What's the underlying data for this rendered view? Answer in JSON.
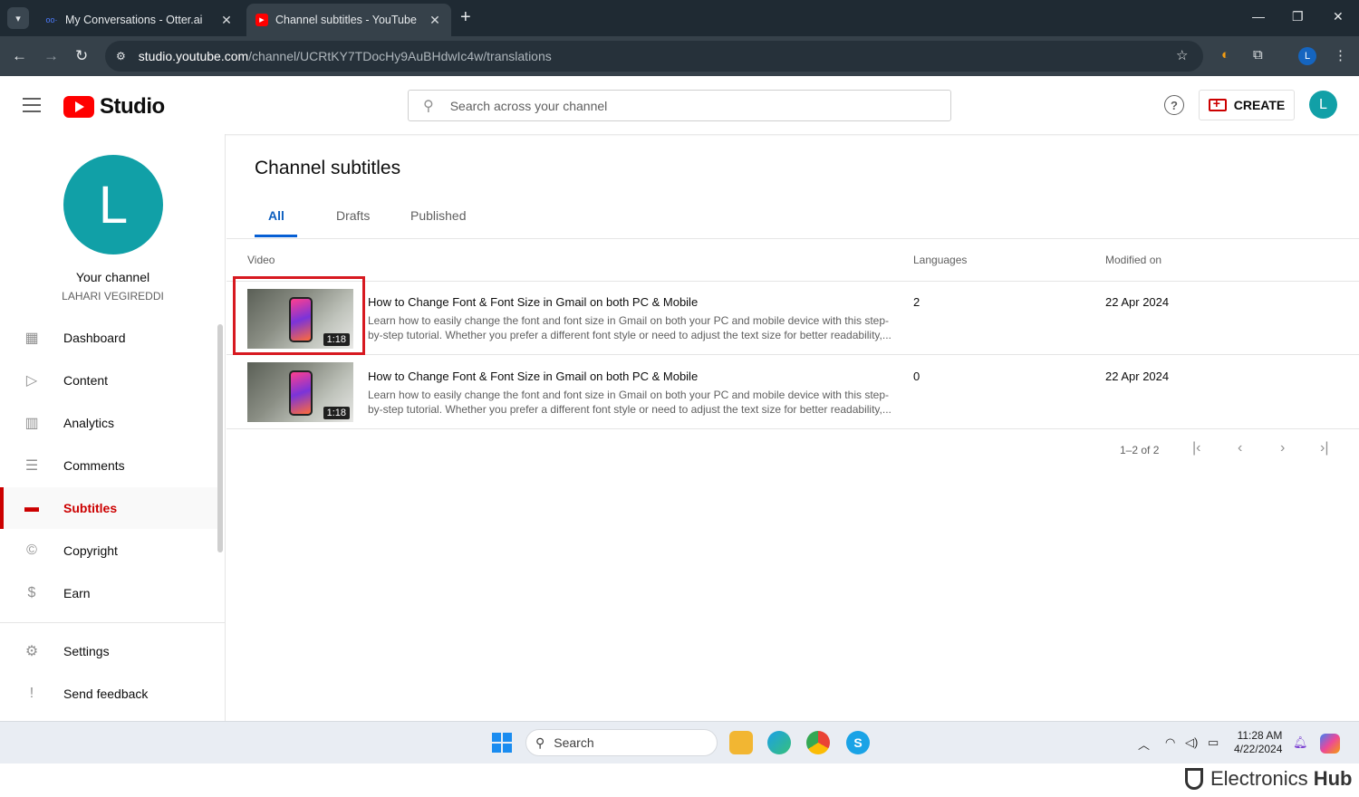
{
  "browser": {
    "tabs": [
      {
        "title": "My Conversations - Otter.ai",
        "active": false
      },
      {
        "title": "Channel subtitles - YouTube Stu",
        "active": true
      }
    ],
    "url_host": "studio.youtube.com",
    "url_path": "/channel/UCRtKY7TDocHy9AuBHdwIc4w/translations",
    "profile_initial": "L"
  },
  "header": {
    "logo_text": "Studio",
    "search_placeholder": "Search across your channel",
    "create_label": "CREATE",
    "avatar_initial": "L"
  },
  "sidebar": {
    "avatar_initial": "L",
    "your_channel": "Your channel",
    "channel_name": "LAHARI VEGIREDDI",
    "items": [
      {
        "label": "Dashboard",
        "icon": "dashboard-icon"
      },
      {
        "label": "Content",
        "icon": "content-icon"
      },
      {
        "label": "Analytics",
        "icon": "analytics-icon"
      },
      {
        "label": "Comments",
        "icon": "comments-icon"
      },
      {
        "label": "Subtitles",
        "icon": "subtitles-icon",
        "active": true
      },
      {
        "label": "Copyright",
        "icon": "copyright-icon"
      },
      {
        "label": "Earn",
        "icon": "earn-icon"
      }
    ],
    "settings": "Settings",
    "feedback": "Send feedback"
  },
  "main": {
    "title": "Channel subtitles",
    "tabs": [
      "All",
      "Drafts",
      "Published"
    ],
    "columns": {
      "video": "Video",
      "languages": "Languages",
      "modified": "Modified on"
    },
    "rows": [
      {
        "title": "How to Change Font & Font Size in Gmail on both PC & Mobile",
        "desc": "Learn how to easily change the font and font size in Gmail on both your PC and mobile device with this step-by-step tutorial. Whether you prefer a different font style or need to adjust the text size for better readability,...",
        "duration": "1:18",
        "languages": "2",
        "modified": "22 Apr 2024"
      },
      {
        "title": "How to Change Font & Font Size in Gmail on both PC & Mobile",
        "desc": "Learn how to easily change the font and font size in Gmail on both your PC and mobile device with this step-by-step tutorial. Whether you prefer a different font style or need to adjust the text size for better readability,...",
        "duration": "1:18",
        "languages": "0",
        "modified": "22 Apr 2024"
      }
    ],
    "pagination": "1–2 of 2"
  },
  "taskbar": {
    "search": "Search",
    "time": "11:28 AM",
    "date": "4/22/2024"
  },
  "watermark": {
    "left": "Electronics",
    "right": "Hub"
  },
  "colors": {
    "accent": "#cc0000",
    "tab_blue": "#065fd4",
    "avatar": "#11a0a7"
  }
}
